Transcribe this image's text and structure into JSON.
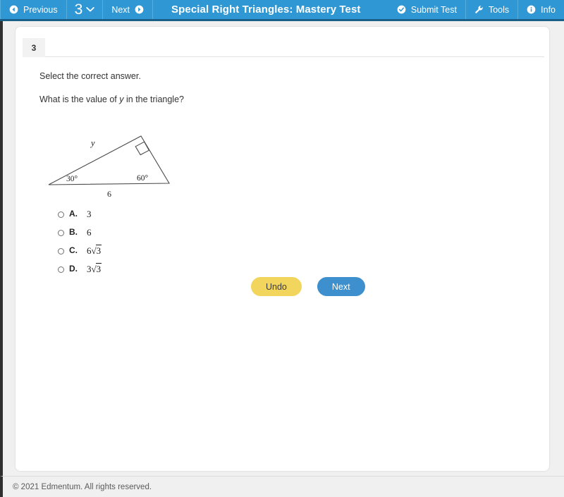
{
  "topbar": {
    "previous_label": "Previous",
    "question_number": "3",
    "next_label": "Next",
    "title": "Special Right Triangles: Mastery Test",
    "submit_label": "Submit Test",
    "tools_label": "Tools",
    "info_label": "Info",
    "background_color": "#2e97d4"
  },
  "tabs": {
    "question_tab_label": "3"
  },
  "question": {
    "instruction": "Select the correct answer.",
    "prompt_before": "What is the value of ",
    "prompt_variable": "y",
    "prompt_after": " in the triangle?"
  },
  "figure": {
    "side_label": "y",
    "angle_left": "30°",
    "angle_right": "60°",
    "base_label": "6",
    "right_angle_marker": "right-angle-square",
    "stroke_color": "#4a4a4a"
  },
  "choices": [
    {
      "letter": "A.",
      "value": "3",
      "radical": false,
      "radicand": ""
    },
    {
      "letter": "B.",
      "value": "6",
      "radical": false,
      "radicand": ""
    },
    {
      "letter": "C.",
      "value": "6",
      "radical": true,
      "radicand": "3"
    },
    {
      "letter": "D.",
      "value": "3",
      "radical": true,
      "radicand": "3"
    }
  ],
  "actions": {
    "undo_label": "Undo",
    "undo_color": "#f2d55c",
    "next_label": "Next",
    "next_color": "#3d8fcd"
  },
  "footer": {
    "copyright": "© 2021 Edmentum. All rights reserved."
  }
}
